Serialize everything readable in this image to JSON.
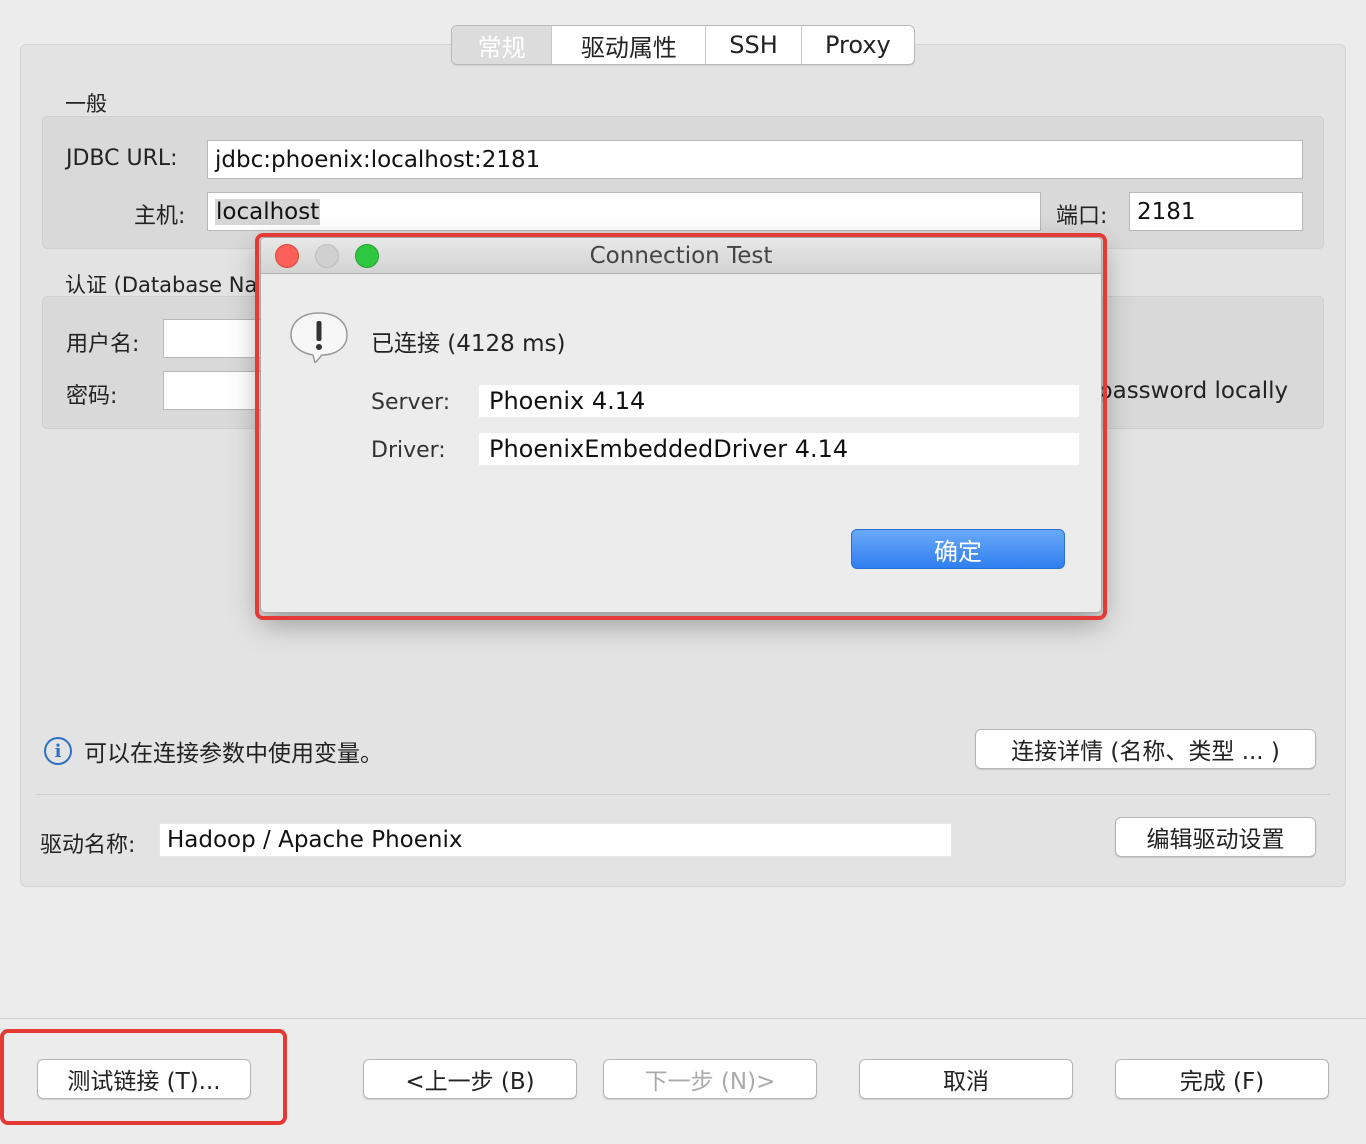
{
  "tabs": [
    "常规",
    "驱动属性",
    "SSH",
    "Proxy"
  ],
  "general": {
    "section_title": "一般",
    "jdbc_label": "JDBC URL:",
    "jdbc_value": "jdbc:phoenix:localhost:2181",
    "host_label": "主机:",
    "host_value": "localhost",
    "port_label": "端口:",
    "port_value": "2181"
  },
  "auth": {
    "section_title": "认证 (Database Na",
    "username_label": "用户名:",
    "password_label": "密码:",
    "save_password_text": "password locally"
  },
  "info": {
    "variables_text": "可以在连接参数中使用变量。",
    "details_button": "连接详情 (名称、类型 ... )"
  },
  "driver": {
    "name_label": "驱动名称:",
    "name_value": "Hadoop / Apache Phoenix",
    "edit_button": "编辑驱动设置"
  },
  "bottom": {
    "test_button": "测试链接 (T)...",
    "back_button": "<上一步 (B)",
    "next_button": "下一步 (N)>",
    "cancel_button": "取消",
    "finish_button": "完成 (F)"
  },
  "dialog": {
    "title": "Connection Test",
    "message": "已连接 (4128 ms)",
    "server_label": "Server:",
    "server_value": "Phoenix 4.14",
    "driver_label": "Driver:",
    "driver_value": "PhoenixEmbeddedDriver 4.14",
    "ok_button": "确定"
  },
  "colors": {
    "highlight_red": "#e53935",
    "accent_blue": "#2f7ef0",
    "close": "#fc5f57",
    "minimize_inactive": "#d0d0d0",
    "zoom": "#2ec840"
  },
  "icons": {
    "alert": "exclamation-alert-icon",
    "info": "info-icon"
  }
}
